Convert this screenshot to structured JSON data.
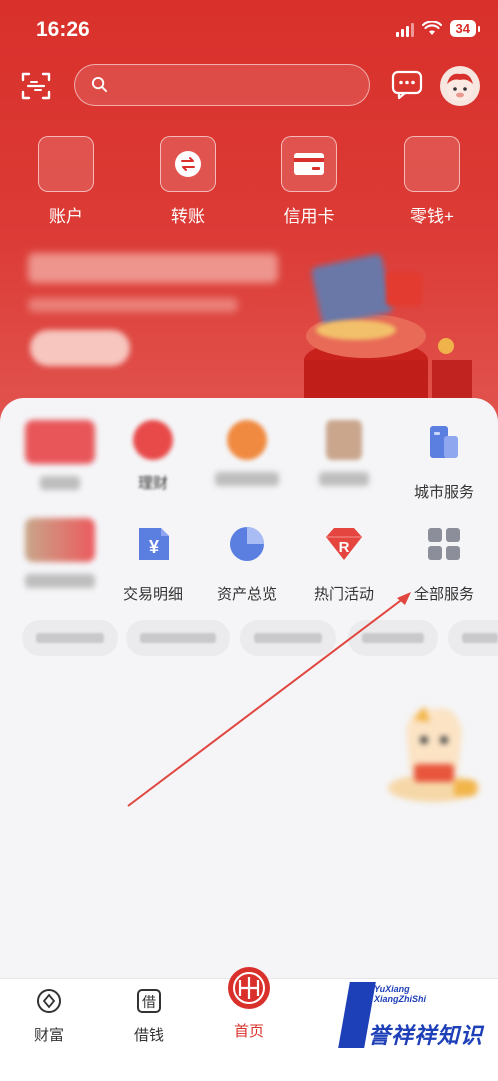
{
  "status_bar": {
    "time": "16:26",
    "battery": "34"
  },
  "search": {
    "placeholder": ""
  },
  "quick_actions": [
    {
      "label": "账户",
      "icon": "account-icon"
    },
    {
      "label": "转账",
      "icon": "transfer-icon"
    },
    {
      "label": "信用卡",
      "icon": "credit-card-icon"
    },
    {
      "label": "零钱+",
      "icon": "change-icon"
    }
  ],
  "services_row1": [
    {
      "label": "",
      "icon": "blurred-icon"
    },
    {
      "label": "理财",
      "icon": "wealth-icon"
    },
    {
      "label": "",
      "icon": "blurred-icon"
    },
    {
      "label": "",
      "icon": "blurred-icon"
    },
    {
      "label": "城市服务",
      "icon": "city-service-icon"
    }
  ],
  "services_row2": [
    {
      "label": "",
      "icon": "blurred-icon"
    },
    {
      "label": "交易明细",
      "icon": "yen-document-icon"
    },
    {
      "label": "资产总览",
      "icon": "pie-chart-icon"
    },
    {
      "label": "热门活动",
      "icon": "gem-icon"
    },
    {
      "label": "全部服务",
      "icon": "grid-icon"
    }
  ],
  "tabs": [
    {
      "label": "财富",
      "icon": "wealth-tab-icon",
      "active": false
    },
    {
      "label": "借钱",
      "icon": "borrow-tab-icon",
      "active": false
    },
    {
      "label": "首页",
      "icon": "citic-logo-icon",
      "active": true
    }
  ],
  "borrow_icon_char": "借",
  "watermark": {
    "small_line1": "YuXiang",
    "small_line2": "XiangZhiShi",
    "big": "誉祥祥知识"
  },
  "colors": {
    "brand_red": "#d9302b",
    "panel_bg": "#f5f5f7",
    "arrow": "#e0463f",
    "watermark_blue": "#1d3fb8"
  }
}
